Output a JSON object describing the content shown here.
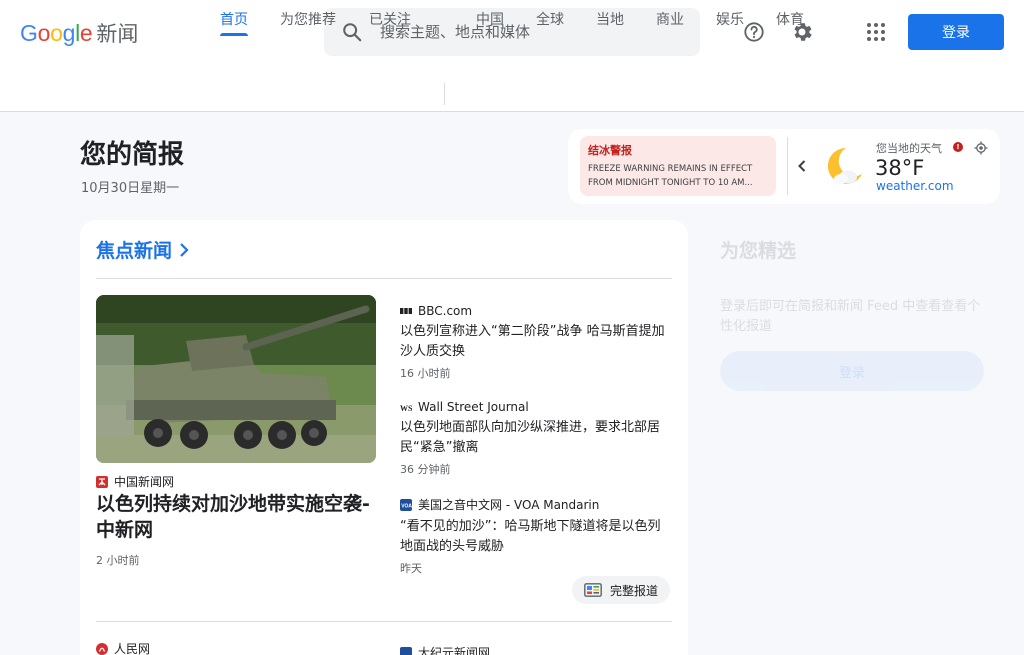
{
  "header": {
    "logo_google": [
      "G",
      "o",
      "o",
      "g",
      "l",
      "e"
    ],
    "logo_colors": [
      "#4285F4",
      "#EA4335",
      "#FBBC05",
      "#4285F4",
      "#34A853",
      "#EA4335"
    ],
    "logo_suffix": "新闻",
    "search_placeholder": "搜索主题、地点和媒体",
    "login_label": "登录",
    "icons": [
      "help-icon",
      "settings-icon",
      "apps-icon"
    ]
  },
  "tabs": {
    "items": [
      "首页",
      "为您推荐",
      "已关注",
      "中国",
      "全球",
      "当地",
      "商业",
      "娱乐",
      "体育"
    ],
    "active": "首页"
  },
  "briefing": {
    "title": "您的简报",
    "date": "10月30日星期一"
  },
  "weather": {
    "alert_title": "结冰警报",
    "alert_text": "FREEZE WARNING REMAINS IN EFFECT FROM MIDNIGHT TONIGHT TO 10 AM...",
    "label": "您当地的天气",
    "alert_badge": "!",
    "temp": "38°F",
    "source": "weather.com"
  },
  "top_stories": {
    "heading": "焦点新闻",
    "hero": {
      "source": "中国新闻网",
      "title": "以色列持续对加沙地带实施空袭-中新网",
      "time": "2 小时前"
    },
    "stories": [
      {
        "source": "BBC.com",
        "title": "以色列宣称进入“第二阶段”战争 哈马斯首提加沙人质交换",
        "time": "16 小时前"
      },
      {
        "source": "Wall Street Journal",
        "title": "以色列地面部队向加沙纵深推进，要求北部居民“紧急”撤离",
        "time": "36 分钟前"
      },
      {
        "source": "美国之音中文网 - VOA Mandarin",
        "title": "“看不见的加沙”：哈马斯地下隧道将是以色列地面战的头号威胁",
        "time": "昨天"
      }
    ],
    "full_coverage": "完整报道",
    "next_sources": [
      "人民网",
      "大纪元新闻网"
    ]
  },
  "picks": {
    "title": "为您精选",
    "text": "登录后即可在简报和新闻 Feed 中查看查看个性化报道",
    "button": "登录"
  },
  "colors": {
    "accent": "#1a73e8",
    "alert_bg": "#fce8e6",
    "alert_red": "#c5221f"
  }
}
